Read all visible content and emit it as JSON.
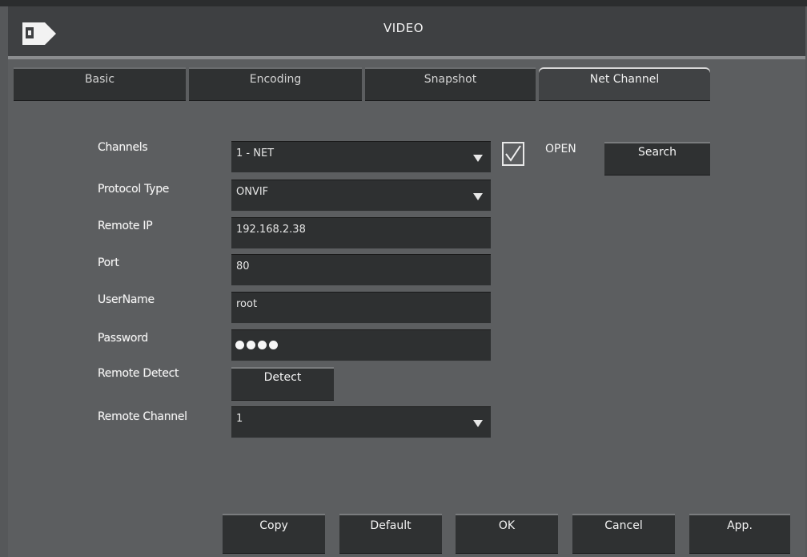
{
  "window": {
    "title": "VIDEO",
    "logo_icon": "exit-arrow-icon"
  },
  "tabs": [
    {
      "label": "Basic",
      "active": false
    },
    {
      "label": "Encoding",
      "active": false
    },
    {
      "label": "Snapshot",
      "active": false
    },
    {
      "label": "Net Channel",
      "active": true
    }
  ],
  "form": {
    "channels": {
      "label": "Channels",
      "value": "1 - NET"
    },
    "protocol_type": {
      "label": "Protocol Type",
      "value": "ONVIF"
    },
    "remote_ip": {
      "label": "Remote IP",
      "value": "192.168.2.38"
    },
    "port": {
      "label": "Port",
      "value": "80"
    },
    "username": {
      "label": "UserName",
      "value": "root"
    },
    "password": {
      "label": "Password",
      "masked_length": 4
    },
    "remote_detect": {
      "label": "Remote Detect",
      "button": "Detect"
    },
    "remote_channel": {
      "label": "Remote Channel",
      "value": "1"
    },
    "open": {
      "label": "OPEN",
      "checked": true
    },
    "search_button": "Search"
  },
  "footer": {
    "copy": "Copy",
    "default": "Default",
    "ok": "OK",
    "cancel": "Cancel",
    "apply": "App."
  }
}
